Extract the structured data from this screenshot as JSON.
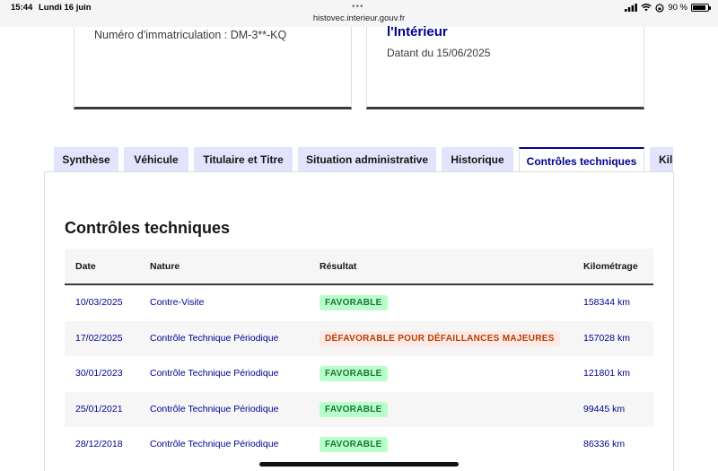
{
  "status_bar": {
    "time": "15:44",
    "date": "Lundi 16 juin",
    "url": "histovec.interieur.gouv.fr",
    "battery": "90 %",
    "battery_level": 0.9
  },
  "cards": {
    "left": {
      "plate": "Numéro d'immatriculation : DM-3**-KQ"
    },
    "right": {
      "title": "l'Intérieur",
      "subtitle": "Datant du 15/06/2025"
    }
  },
  "tabs": [
    {
      "label": "Synthèse"
    },
    {
      "label": "Véhicule"
    },
    {
      "label": "Titulaire et Titre"
    },
    {
      "label": "Situation administrative"
    },
    {
      "label": "Historique"
    },
    {
      "label": "Contrôles techniques",
      "active": true
    },
    {
      "label": "Kilo"
    }
  ],
  "section": {
    "title": "Contrôles techniques"
  },
  "table": {
    "headers": {
      "date": "Date",
      "nature": "Nature",
      "result": "Résultat",
      "mileage": "Kilométrage"
    },
    "rows": [
      {
        "date": "10/03/2025",
        "nature": "Contre-Visite",
        "result": "FAVORABLE",
        "mileage": "158344 km"
      },
      {
        "date": "17/02/2025",
        "nature": "Contrôle Technique Périodique",
        "result": "DÉFAVORABLE POUR DÉFAILLANCES MAJEURES",
        "mileage": "157028 km"
      },
      {
        "date": "30/01/2023",
        "nature": "Contrôle Technique Périodique",
        "result": "FAVORABLE",
        "mileage": "121801 km"
      },
      {
        "date": "25/01/2021",
        "nature": "Contrôle Technique Périodique",
        "result": "FAVORABLE",
        "mileage": "99445 km"
      },
      {
        "date": "28/12/2018",
        "nature": "Contrôle Technique Périodique",
        "result": "FAVORABLE",
        "mileage": "86336 km"
      }
    ]
  },
  "colors": {
    "accent": "#000091",
    "tab_bg": "#e3e3fd",
    "success_bg": "#b8fec9",
    "success_text": "#18753c",
    "error_bg": "#ffe9e6",
    "error_text": "#b34000"
  }
}
